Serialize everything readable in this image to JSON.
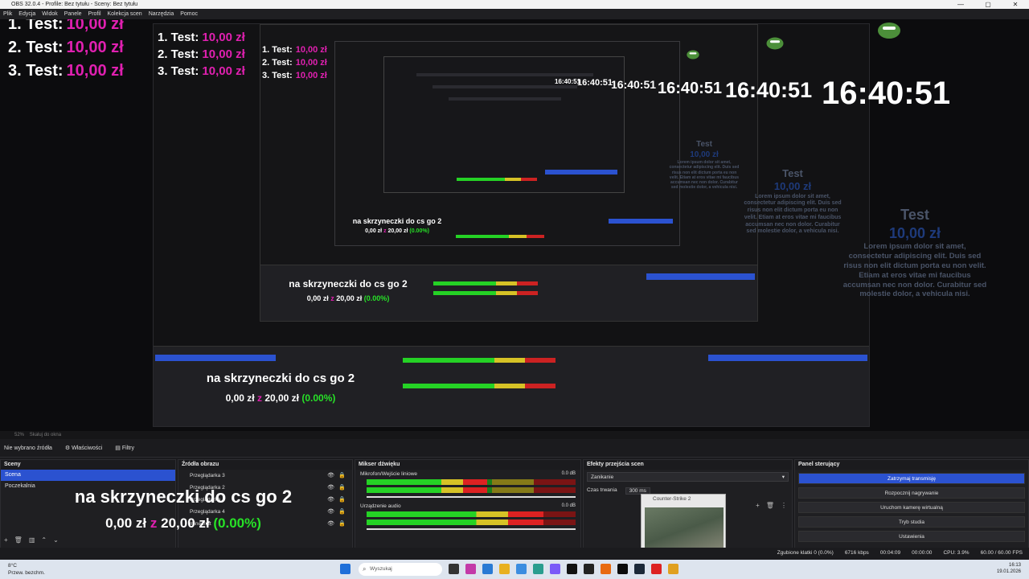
{
  "window": {
    "title": "OBS 32.0.4 - Profile: Bez tytułu - Sceny: Bez tytułu",
    "controls": [
      "—",
      "▢",
      "✕"
    ]
  },
  "menu": [
    "Plik",
    "Edycja",
    "Widok",
    "Panele",
    "Profil",
    "Kolekcja scen",
    "Narzędzia",
    "Pomoc"
  ],
  "overlay": {
    "leaderboard": [
      {
        "label": "1. Test:",
        "amount": "10,00 zł"
      },
      {
        "label": "2. Test:",
        "amount": "10,00 zł"
      },
      {
        "label": "3. Test:",
        "amount": "10,00 zł"
      }
    ],
    "clock": "16:40:51",
    "lorem_title": "Test",
    "lorem_amount": "10,00 zł",
    "lorem_text": "Lorem ipsum dolor sit amet, consectetur adipiscing elit. Duis sed risus non elit dictum porta eu non velit. Etiam at eros vitae mi faucibus accumsan nec non dolor. Curabitur sed molestie dolor, a vehicula nisi.",
    "donation_title": "na skrzyneczki do cs go 2",
    "donation_current": "0,00 zł",
    "donation_sep": "z",
    "donation_goal": "20,00 zł",
    "donation_pct": "(0.00%)"
  },
  "preview_status": {
    "zoom": "52%",
    "mode": "Skaluj do okna"
  },
  "source_bar": {
    "selection": "Nie wybrano źródła",
    "properties": "Właściwości",
    "filters": "Filtry"
  },
  "scenes": {
    "header": "Sceny",
    "items": [
      {
        "label": "Scena",
        "selected": true
      },
      {
        "label": "Poczekalnia",
        "selected": false
      }
    ]
  },
  "sources": {
    "header": "Źródła obrazu",
    "items": [
      "Przeglądarka 3",
      "Przeglądarka 2",
      "Przeglądarka",
      "Przeglądarka 4",
      "minecraft"
    ]
  },
  "mixer": {
    "header": "Mikser dźwięku",
    "channels": [
      {
        "name": "Mikrofon/Wejście liniowe",
        "db": "0.0 dB"
      },
      {
        "name": "Urządzenie audio",
        "db": "0.0 dB"
      }
    ]
  },
  "transitions": {
    "header": "Efekty przejścia scen",
    "type": "Zanikanie",
    "duration_label": "Czas trwania",
    "duration_value": "300 ms"
  },
  "controls": {
    "header": "Panel sterujący",
    "buttons": [
      {
        "label": "Zatrzymaj transmisję",
        "active": true
      },
      {
        "label": "Rozpocznij nagrywanie",
        "active": false
      },
      {
        "label": "Uruchom kamerę wirtualną",
        "active": false
      },
      {
        "label": "Tryb studia",
        "active": false
      },
      {
        "label": "Ustawienia",
        "active": false
      }
    ]
  },
  "statusbar": {
    "dropped": "Zgubione klatki 0 (0.0%)",
    "bitrate": "6716 kbps",
    "stream_time": "00:04:09",
    "rec_time": "00:00:00",
    "cpu": "CPU: 3.9%",
    "fps": "60.00 / 60.00 FPS"
  },
  "thumbnail": {
    "caption": "Counter-Strike 2"
  },
  "taskbar": {
    "weather_temp": "8°C",
    "weather_desc": "Przew. bezchm.",
    "search": "Wyszukaj",
    "time": "16:13",
    "date": "19.01.2026"
  },
  "colors": {
    "accent": "#2b52d0",
    "pink": "#e020b0",
    "green": "#27e227"
  }
}
